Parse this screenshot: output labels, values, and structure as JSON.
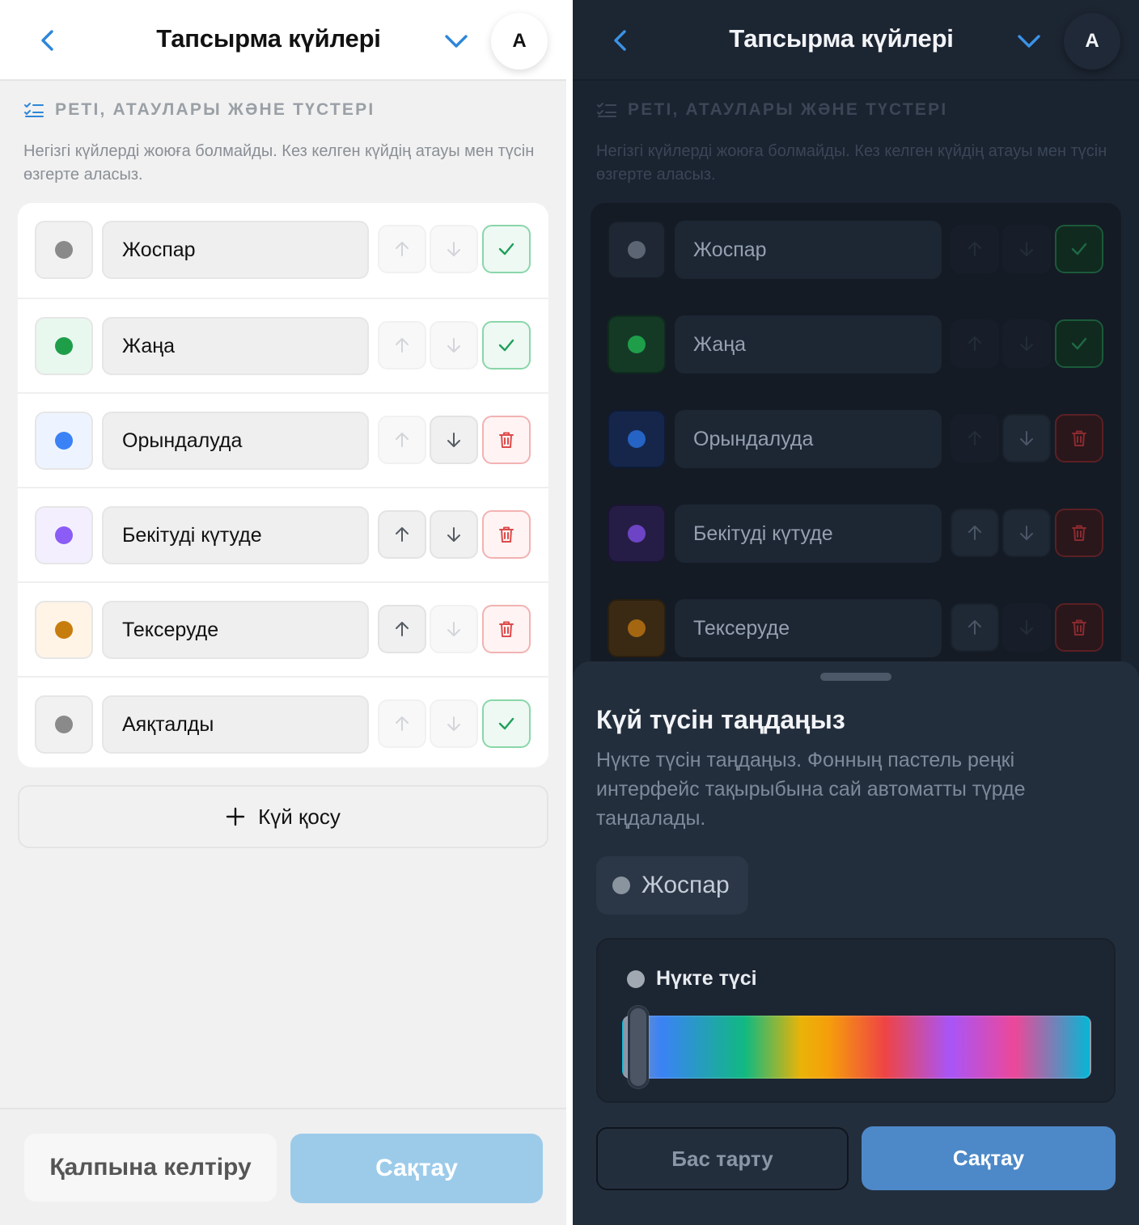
{
  "accent": "#2e86d8",
  "header": {
    "title": "Тапсырма күйлері",
    "avatar": "A"
  },
  "section": {
    "title": "РЕТІ, АТАУЛАРЫ ЖӘНЕ ТҮСТЕРІ",
    "desc": "Негізгі күйлерді жоюға болмайды. Кез келген күйдің атауы мен түсін өзгерте аласыз."
  },
  "statuses": [
    {
      "name": "Жоспар",
      "dot": "#8a8a8a",
      "bg": "#f1f1f1",
      "dark_dot": "#5b6573",
      "dark_bg": "#1f2734",
      "up": false,
      "down": false,
      "action": "confirm"
    },
    {
      "name": "Жаңа",
      "dot": "#1f9e4a",
      "bg": "#e9f8ef",
      "dark_dot": "#1f9e4a",
      "dark_bg": "#143a26",
      "up": false,
      "down": false,
      "action": "confirm"
    },
    {
      "name": "Орындалуда",
      "dot": "#3b82f6",
      "bg": "#eef4ff",
      "dark_dot": "#2563c4",
      "dark_bg": "#15264a",
      "up": false,
      "down": true,
      "action": "delete"
    },
    {
      "name": "Бекітуді күтуде",
      "dot": "#8b5cf6",
      "bg": "#f4efff",
      "dark_dot": "#6d44c5",
      "dark_bg": "#261d46",
      "up": true,
      "down": true,
      "action": "delete"
    },
    {
      "name": "Тексеруде",
      "dot": "#c77d0e",
      "bg": "#fff4e6",
      "dark_dot": "#a46611",
      "dark_bg": "#3a2a14",
      "up": true,
      "down": false,
      "action": "delete"
    },
    {
      "name": "Аяқталды",
      "dot": "#8a8a8a",
      "bg": "#f1f1f1",
      "up": false,
      "down": false,
      "action": "confirm"
    }
  ],
  "add_label": "Күй қосу",
  "footer": {
    "reset": "Қалпына келтіру",
    "save": "Сақтау"
  },
  "sheet": {
    "title": "Күй түсін таңдаңыз",
    "desc": "Нүкте түсін таңдаңыз. Фонның пастель реңкі интерфейс тақырыбына сай автоматты түрде таңдалады.",
    "chip": "Жоспар",
    "picker_label": "Нүкте түсі",
    "hue": 0,
    "cancel": "Бас тарту",
    "save": "Сақтау"
  },
  "icons": [
    "back-icon",
    "chevron-down-icon",
    "checklist-icon",
    "arrow-up-icon",
    "arrow-down-icon",
    "check-icon",
    "trash-icon",
    "plus-icon"
  ]
}
